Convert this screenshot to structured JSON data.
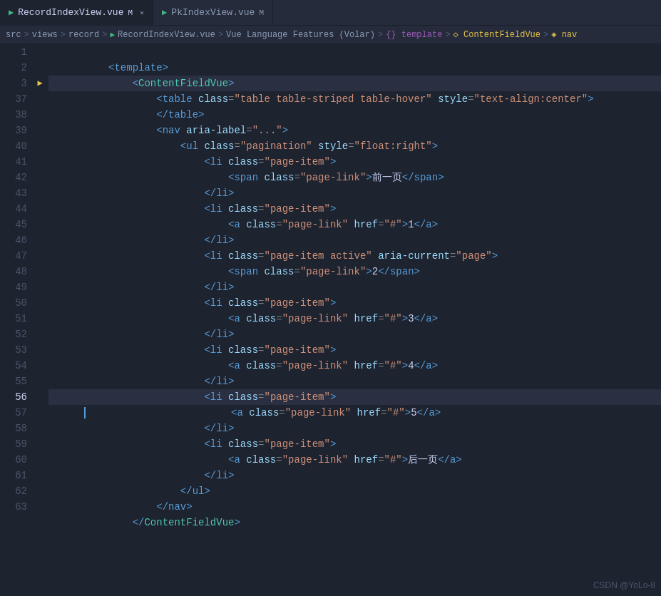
{
  "tabs": [
    {
      "id": "record",
      "label": "RecordIndexView.vue",
      "modified": true,
      "active": true
    },
    {
      "id": "pk",
      "label": "PkIndexView.vue",
      "modified": true,
      "active": false
    }
  ],
  "breadcrumb": {
    "parts": [
      {
        "text": "src",
        "type": "text"
      },
      {
        "text": ">",
        "type": "sep"
      },
      {
        "text": "views",
        "type": "text"
      },
      {
        "text": ">",
        "type": "sep"
      },
      {
        "text": "record",
        "type": "text"
      },
      {
        "text": ">",
        "type": "sep"
      },
      {
        "text": "RecordIndexView.vue",
        "type": "vue"
      },
      {
        "text": ">",
        "type": "sep"
      },
      {
        "text": "Vue Language Features (Volar)",
        "type": "text"
      },
      {
        "text": ">",
        "type": "sep"
      },
      {
        "text": "{} template",
        "type": "curly"
      },
      {
        "text": ">",
        "type": "sep"
      },
      {
        "text": "◇ ContentFieldVue",
        "type": "component"
      },
      {
        "text": ">",
        "type": "sep"
      },
      {
        "text": "◈ nav",
        "type": "nav"
      }
    ]
  },
  "lines": [
    {
      "num": 1,
      "content": "    <template>",
      "highlight": false
    },
    {
      "num": 2,
      "content": "        <ContentFieldVue>",
      "highlight": false
    },
    {
      "num": 3,
      "content": "            <table class=\"table table-striped table-hover\" style=\"text-align:center\">",
      "highlight": true,
      "arrow": true
    },
    {
      "num": 37,
      "content": "            </table>",
      "highlight": false
    },
    {
      "num": 38,
      "content": "            <nav aria-label=\"...\">",
      "highlight": false
    },
    {
      "num": 39,
      "content": "                <ul class=\"pagination\" style=\"float:right\">",
      "highlight": false
    },
    {
      "num": 40,
      "content": "                    <li class=\"page-item\">",
      "highlight": false
    },
    {
      "num": 41,
      "content": "                        <span class=\"page-link\">前一页</span>",
      "highlight": false
    },
    {
      "num": 42,
      "content": "                    </li>",
      "highlight": false
    },
    {
      "num": 43,
      "content": "                    <li class=\"page-item\">",
      "highlight": false
    },
    {
      "num": 44,
      "content": "                        <a class=\"page-link\" href=\"#\">1</a>",
      "highlight": false
    },
    {
      "num": 45,
      "content": "                    </li>",
      "highlight": false
    },
    {
      "num": 46,
      "content": "                    <li class=\"page-item active\" aria-current=\"page\">",
      "highlight": false
    },
    {
      "num": 47,
      "content": "                        <span class=\"page-link\">2</span>",
      "highlight": false
    },
    {
      "num": 48,
      "content": "                    </li>",
      "highlight": false
    },
    {
      "num": 49,
      "content": "                    <li class=\"page-item\">",
      "highlight": false
    },
    {
      "num": 50,
      "content": "                        <a class=\"page-link\" href=\"#\">3</a>",
      "highlight": false
    },
    {
      "num": 51,
      "content": "                    </li>",
      "highlight": false
    },
    {
      "num": 52,
      "content": "                    <li class=\"page-item\">",
      "highlight": false
    },
    {
      "num": 53,
      "content": "                        <a class=\"page-link\" href=\"#\">4</a>",
      "highlight": false
    },
    {
      "num": 54,
      "content": "                    </li>",
      "highlight": false
    },
    {
      "num": 55,
      "content": "                    <li class=\"page-item\">",
      "highlight": false
    },
    {
      "num": 56,
      "content": "                        <a class=\"page-link\" href=\"#\">5</a>",
      "highlight": true
    },
    {
      "num": 57,
      "content": "                    </li>",
      "highlight": false
    },
    {
      "num": 58,
      "content": "                    <li class=\"page-item\">",
      "highlight": false
    },
    {
      "num": 59,
      "content": "                        <a class=\"page-link\" href=\"#\">后一页</a>",
      "highlight": false
    },
    {
      "num": 60,
      "content": "                    </li>",
      "highlight": false
    },
    {
      "num": 61,
      "content": "                </ul>",
      "highlight": false
    },
    {
      "num": 62,
      "content": "            </nav>",
      "highlight": false
    },
    {
      "num": 63,
      "content": "        </ContentFieldVue>",
      "highlight": false
    }
  ],
  "watermark": "CSDN @YoLo-8"
}
